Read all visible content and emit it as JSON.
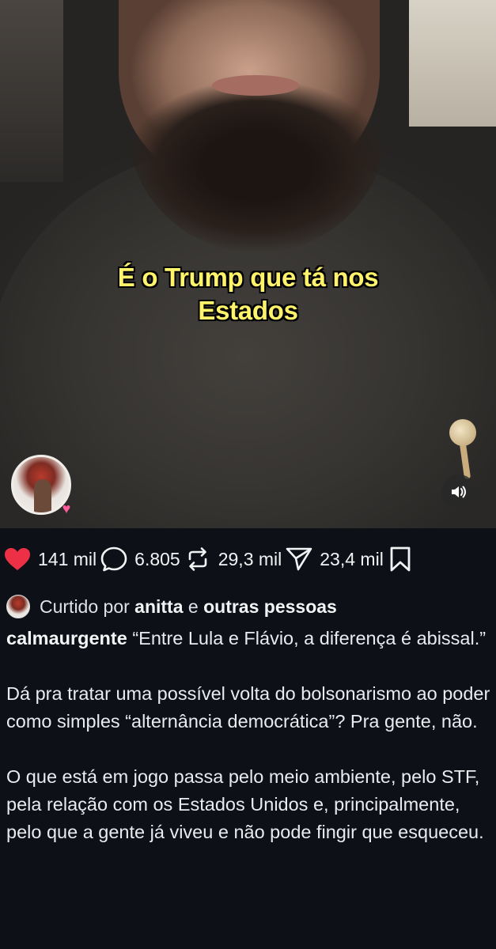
{
  "video": {
    "caption_line1": "É o Trump que tá nos",
    "caption_line2": "Estados",
    "avatar_icon": "profile-avatar",
    "badge_icon": "heart-badge-icon",
    "mute_icon": "speaker-icon"
  },
  "actions": {
    "likes": "141 mil",
    "comments": "6.805",
    "reposts": "29,3 mil",
    "shares": "23,4 mil",
    "like_color": "#ed3046"
  },
  "liked_by": {
    "prefix": "Curtido por",
    "user": "anitta",
    "connector": "e",
    "others": "outras pessoas"
  },
  "post": {
    "username": "calmaurgente",
    "paragraph1": "“Entre Lula e Flávio, a diferença é abissal.”",
    "paragraph2": "Dá pra tratar uma possível volta do bolsonarismo ao poder como simples “alternância democrática”? Pra gente, não.",
    "paragraph3": "O que está em jogo passa pelo meio ambiente, pelo STF, pela relação com os Estados Unidos e, principalmente, pelo que a gente já viveu e não pode fingir que esqueceu."
  }
}
